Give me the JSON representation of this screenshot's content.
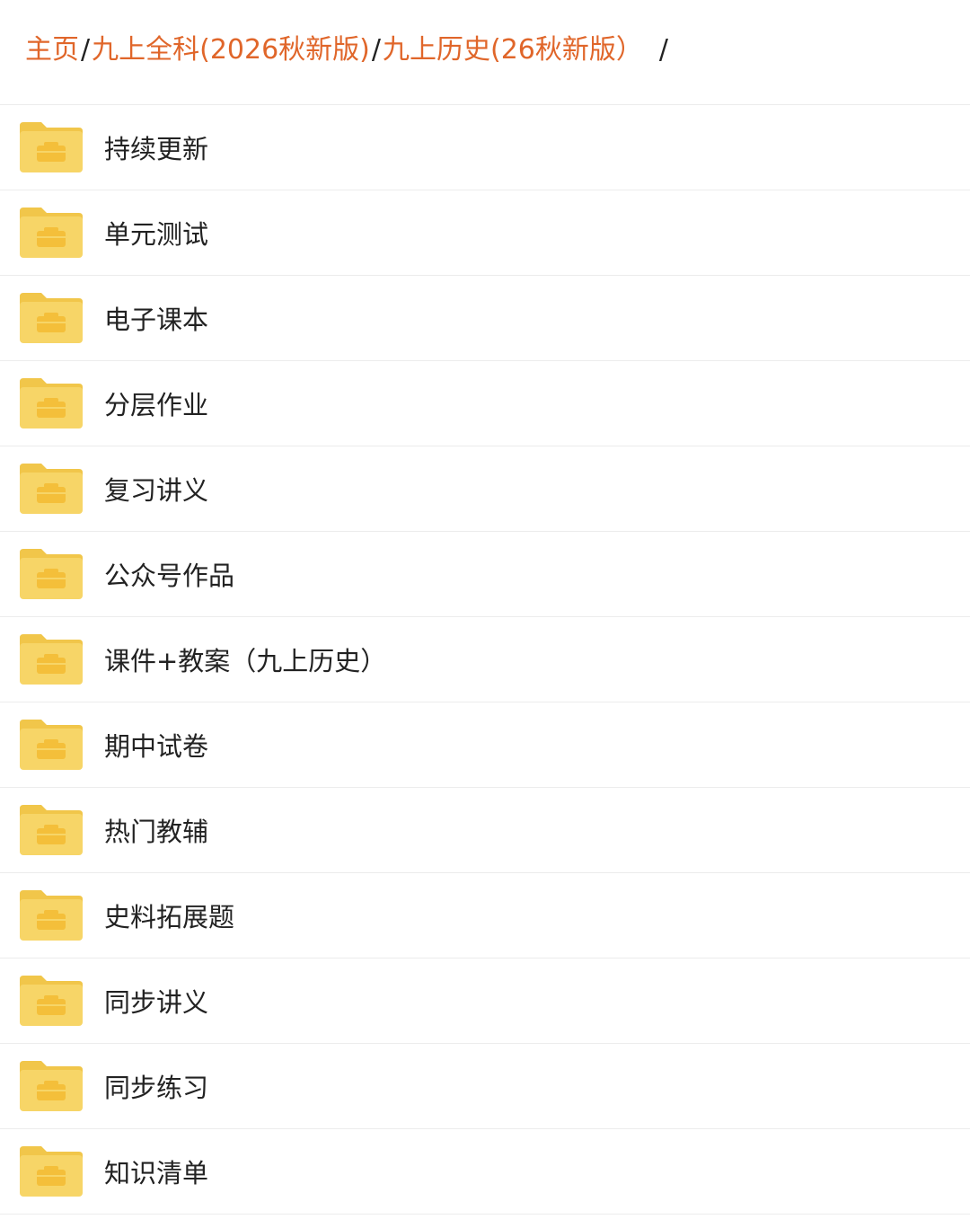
{
  "breadcrumb": {
    "items": [
      "主页",
      "九上全科(2026秋新版)",
      "九上历史(26秋新版）"
    ],
    "separator": "/"
  },
  "folder_icon": "folder-icon",
  "colors": {
    "breadcrumb_link": "#e0662a",
    "folder_body": "#f7d567",
    "folder_tab": "#f1c64a",
    "text": "#222222"
  },
  "folders": [
    {
      "name": "持续更新"
    },
    {
      "name": "单元测试"
    },
    {
      "name": "电子课本"
    },
    {
      "name": "分层作业"
    },
    {
      "name": "复习讲义"
    },
    {
      "name": "公众号作品"
    },
    {
      "name": "课件+教案（九上历史）"
    },
    {
      "name": "期中试卷"
    },
    {
      "name": "热门教辅"
    },
    {
      "name": "史料拓展题"
    },
    {
      "name": "同步讲义"
    },
    {
      "name": "同步练习"
    },
    {
      "name": "知识清单"
    }
  ]
}
